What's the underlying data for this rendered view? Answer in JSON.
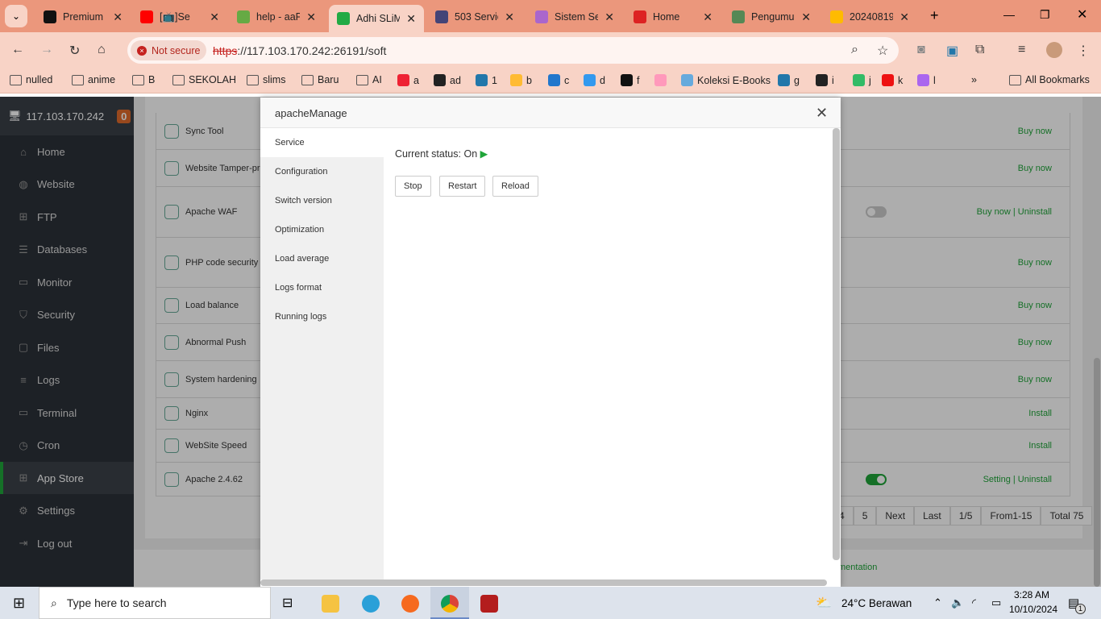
{
  "browser": {
    "tabs": [
      {
        "label": "Premium",
        "color": "#111"
      },
      {
        "label": "[📺]Se",
        "color": "#f00"
      },
      {
        "label": "help - aaP",
        "color": "#6a4"
      },
      {
        "label": "Adhi SLiM",
        "color": "#2a4",
        "active": true
      },
      {
        "label": "503 Servic",
        "color": "#447"
      },
      {
        "label": "Sistem Se",
        "color": "#a6c"
      },
      {
        "label": "Home",
        "color": "#d22"
      },
      {
        "label": "Pengumu",
        "color": "#585"
      },
      {
        "label": "20240819",
        "color": "#fb0"
      }
    ],
    "not_secure": "Not secure",
    "url_scheme": "https",
    "url_rest": "://117.103.170.242:26191/soft",
    "bookmarks": [
      {
        "label": "nulled",
        "folder": true
      },
      {
        "label": "anime",
        "folder": true
      },
      {
        "label": "B",
        "folder": true
      },
      {
        "label": "SEKOLAH",
        "folder": true
      },
      {
        "label": "slims",
        "folder": true
      },
      {
        "label": "Baru",
        "folder": true
      },
      {
        "label": "AI",
        "folder": true
      },
      {
        "label": "a",
        "color": "#e23"
      },
      {
        "label": "ad",
        "color": "#222"
      },
      {
        "label": "1",
        "color": "#27a"
      },
      {
        "label": "b",
        "color": "#fb3"
      },
      {
        "label": "c",
        "color": "#27c"
      },
      {
        "label": "d",
        "color": "#39e"
      },
      {
        "label": "f",
        "color": "#111"
      },
      {
        "label": "",
        "color": "#f9b"
      },
      {
        "label": "Koleksi E-Books",
        "color": "#6ad"
      },
      {
        "label": "g",
        "color": "#27a"
      },
      {
        "label": "i",
        "color": "#222"
      },
      {
        "label": "j",
        "color": "#3b6"
      },
      {
        "label": "k",
        "color": "#e11"
      },
      {
        "label": "l",
        "color": "#a6e"
      }
    ],
    "more": "»",
    "all_bookmarks": "All Bookmarks"
  },
  "sidebar": {
    "host": "117.103.170.242",
    "badge": "0",
    "items": [
      {
        "label": "Home",
        "icon": "⌂"
      },
      {
        "label": "Website",
        "icon": "◍"
      },
      {
        "label": "FTP",
        "icon": "⊞"
      },
      {
        "label": "Databases",
        "icon": "☰"
      },
      {
        "label": "Monitor",
        "icon": "▭"
      },
      {
        "label": "Security",
        "icon": "⛉"
      },
      {
        "label": "Files",
        "icon": "▢"
      },
      {
        "label": "Logs",
        "icon": "≡"
      },
      {
        "label": "Terminal",
        "icon": "▭"
      },
      {
        "label": "Cron",
        "icon": "◷"
      },
      {
        "label": "App Store",
        "icon": "⊞",
        "active": true
      },
      {
        "label": "Settings",
        "icon": "⚙"
      },
      {
        "label": "Log out",
        "icon": "⇥"
      }
    ]
  },
  "apps": [
    {
      "name": "Sync Tool",
      "action": "Buy now"
    },
    {
      "name": "Website Tamper-pro",
      "action": "Buy now"
    },
    {
      "name": "Apache WAF",
      "action": "Buy now | Uninstall",
      "toggle": "off"
    },
    {
      "name": "PHP code security",
      "action": "Buy now"
    },
    {
      "name": "Load balance",
      "action": "Buy now"
    },
    {
      "name": "Abnormal Push",
      "action": "Buy now"
    },
    {
      "name": "System hardening",
      "action": "Buy now"
    },
    {
      "name": "Nginx",
      "action": "Install"
    },
    {
      "name": "WebSite Speed",
      "action": "Install"
    },
    {
      "name": "Apache 2.4.62",
      "action": "Setting | Uninstall",
      "toggle": "on"
    }
  ],
  "pager": [
    "4",
    "5",
    "Next",
    "Last",
    "1/5",
    "From1-15",
    "Total 75"
  ],
  "footer_link": "mentation",
  "modal": {
    "title": "apacheManage",
    "nav": [
      "Service",
      "Configuration",
      "Switch version",
      "Optimization",
      "Load average",
      "Logs format",
      "Running logs"
    ],
    "status_label": "Current status:",
    "status_value": "On",
    "buttons": [
      "Stop",
      "Restart",
      "Reload"
    ]
  },
  "taskbar": {
    "search_placeholder": "Type here to search",
    "weather": "24°C  Berawan",
    "time": "3:28 AM",
    "date": "10/10/2024",
    "notif": "1"
  }
}
